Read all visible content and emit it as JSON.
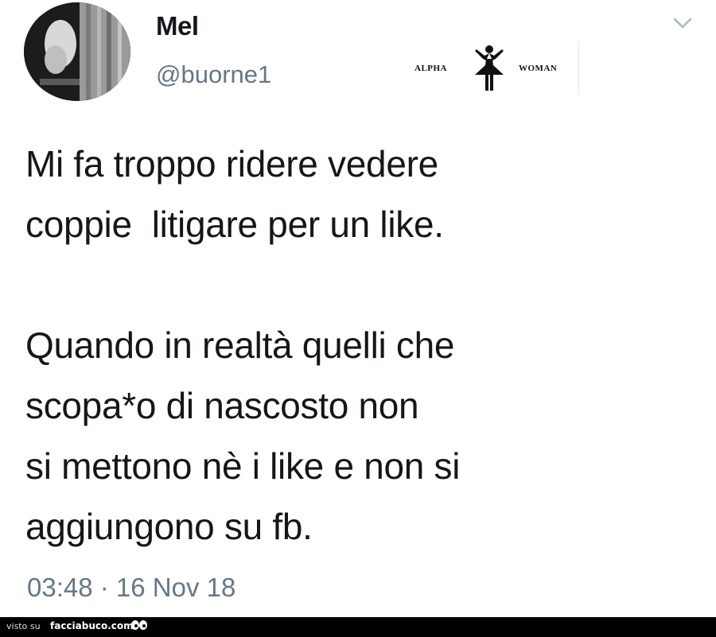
{
  "tweet": {
    "author_name": "Mel",
    "author_handle": "@buorne1",
    "menu_icon": "chevron-down-icon",
    "body_lines": [
      "Mi fa troppo ridere vedere",
      "coppie  litigare per un like.",
      "",
      "Quando in realtà quelli che",
      "scopa*o di nascosto non",
      "si mettono nè i like e non si",
      "aggiungono su fb."
    ],
    "timestamp": "03:48 · 16 Nov 18"
  },
  "watermark": {
    "left_text": "ALPHA",
    "right_text": "WOMAN"
  },
  "footer": {
    "prefix": "visto su",
    "site": "facciabuco.com"
  },
  "colors": {
    "text_primary": "#14171a",
    "text_secondary": "#657786",
    "footer_bg": "#000000"
  }
}
